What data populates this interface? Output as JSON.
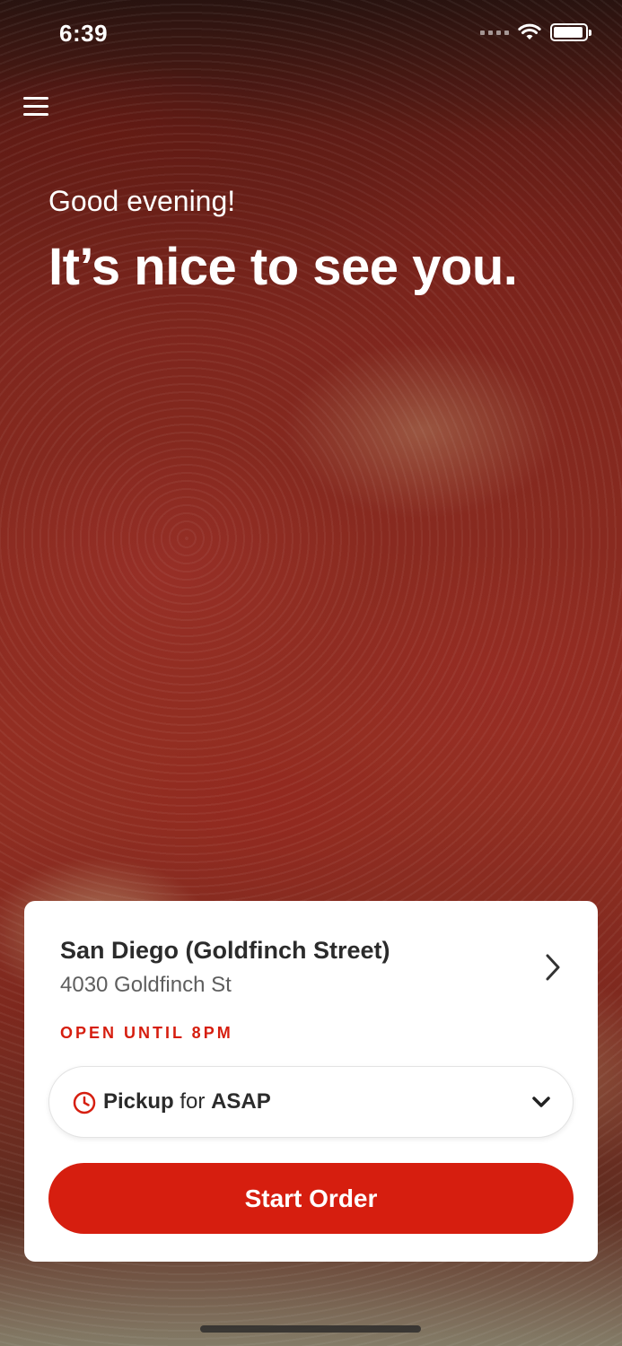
{
  "status_bar": {
    "time": "6:39"
  },
  "header": {
    "greeting": "Good evening!",
    "headline": "It’s nice to see you."
  },
  "store": {
    "name": "San Diego (Goldfinch Street)",
    "address": "4030 Goldfinch St",
    "hours": "OPEN UNTIL 8PM"
  },
  "order": {
    "method": "Pickup",
    "connector": "for",
    "time": "ASAP",
    "start_label": "Start Order"
  },
  "colors": {
    "accent": "#d61e0f",
    "card_bg": "#ffffff",
    "text_dark": "#2b2b2b",
    "text_muted": "#5e5e5e"
  },
  "icons": [
    "hamburger-menu-icon",
    "wifi-icon",
    "battery-icon",
    "chevron-right-icon",
    "clock-icon",
    "chevron-down-icon"
  ]
}
